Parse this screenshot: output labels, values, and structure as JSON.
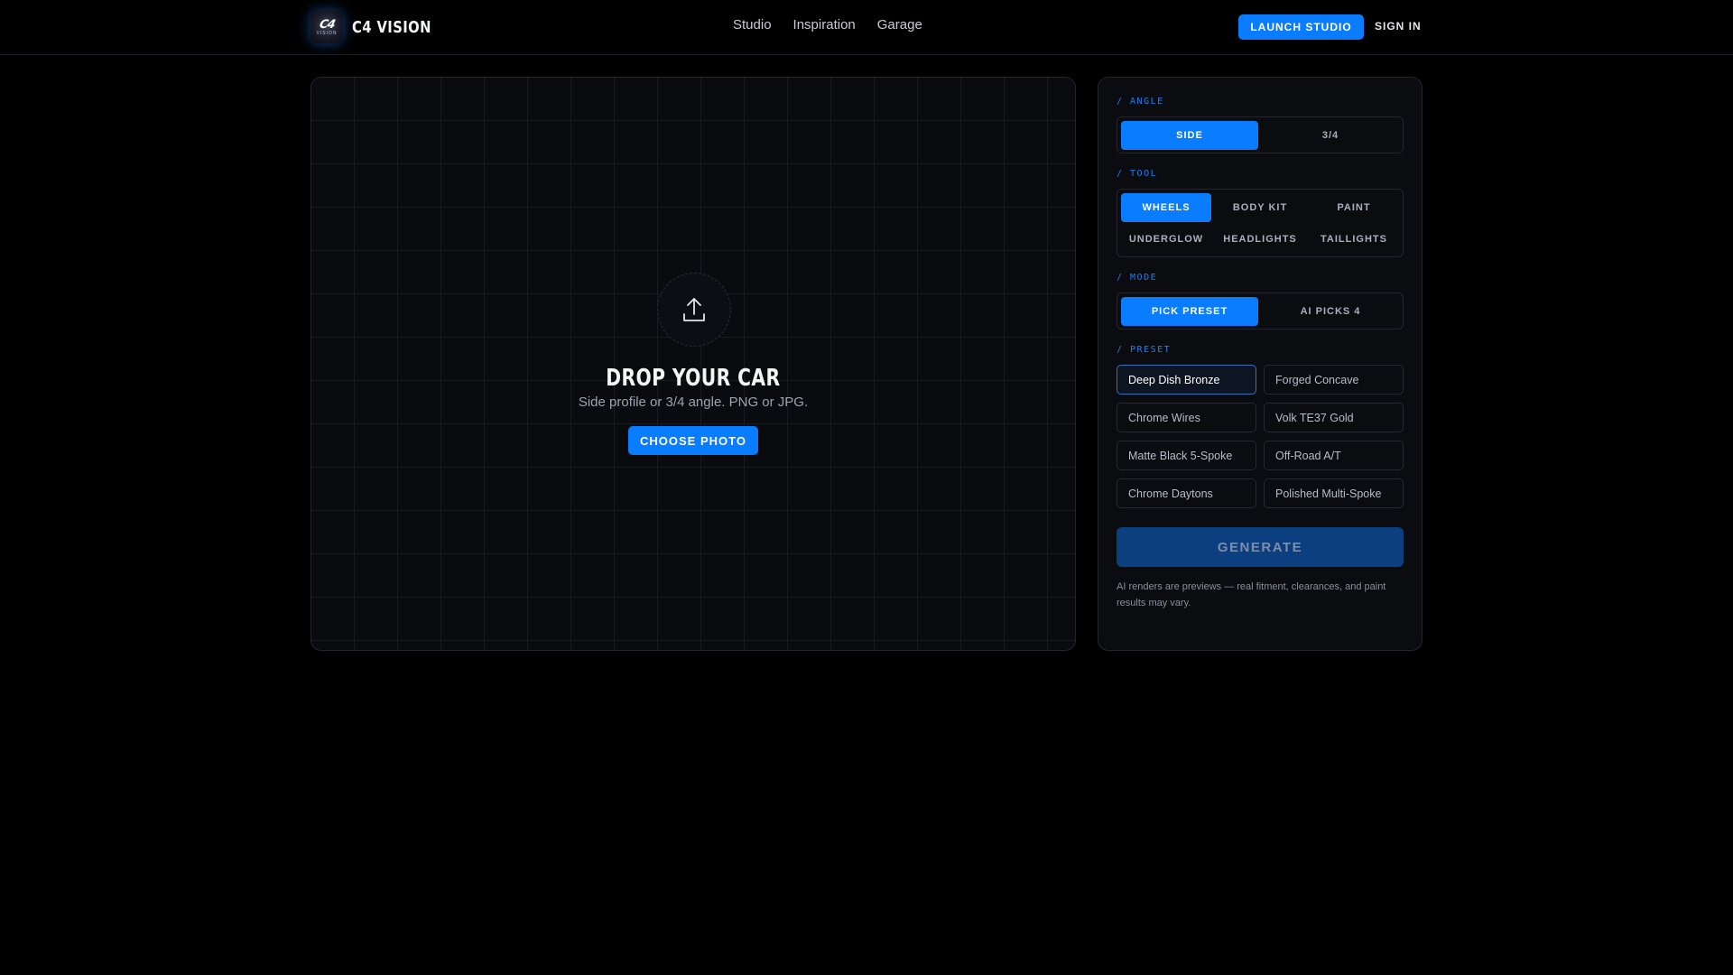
{
  "header": {
    "brand_logo_text": "C4",
    "brand_logo_subtext": "VISION",
    "brand_name": "C4 VISION",
    "nav": [
      "Studio",
      "Inspiration",
      "Garage"
    ],
    "launch_label": "LAUNCH STUDIO",
    "signin_label": "SIGN IN"
  },
  "dropzone": {
    "icon": "upload-icon",
    "title": "DROP YOUR CAR",
    "subtitle": "Side profile or 3/4 angle. PNG or JPG.",
    "button_label": "CHOOSE PHOTO"
  },
  "panel": {
    "angle": {
      "label": "/ ANGLE",
      "options": [
        "SIDE",
        "3/4"
      ],
      "selected": "SIDE"
    },
    "tool": {
      "label": "/ TOOL",
      "options": [
        "WHEELS",
        "BODY KIT",
        "PAINT",
        "UNDERGLOW",
        "HEADLIGHTS",
        "TAILLIGHTS"
      ],
      "selected": "WHEELS"
    },
    "mode": {
      "label": "/ MODE",
      "options": [
        "PICK PRESET",
        "AI PICKS 4"
      ],
      "selected": "PICK PRESET"
    },
    "preset": {
      "label": "/ PRESET",
      "options": [
        "Deep Dish Bronze",
        "Forged Concave",
        "Chrome Wires",
        "Volk TE37 Gold",
        "Matte Black 5-Spoke",
        "Off-Road A/T",
        "Chrome Daytons",
        "Polished Multi-Spoke"
      ],
      "selected": "Deep Dish Bronze"
    },
    "generate_label": "GENERATE",
    "disclaimer": "AI renders are previews — real fitment, clearances, and paint results may vary."
  },
  "colors": {
    "accent": "#0a7cff",
    "background": "#000000",
    "panel": "#0b0c10",
    "label": "#1f7ff0"
  }
}
